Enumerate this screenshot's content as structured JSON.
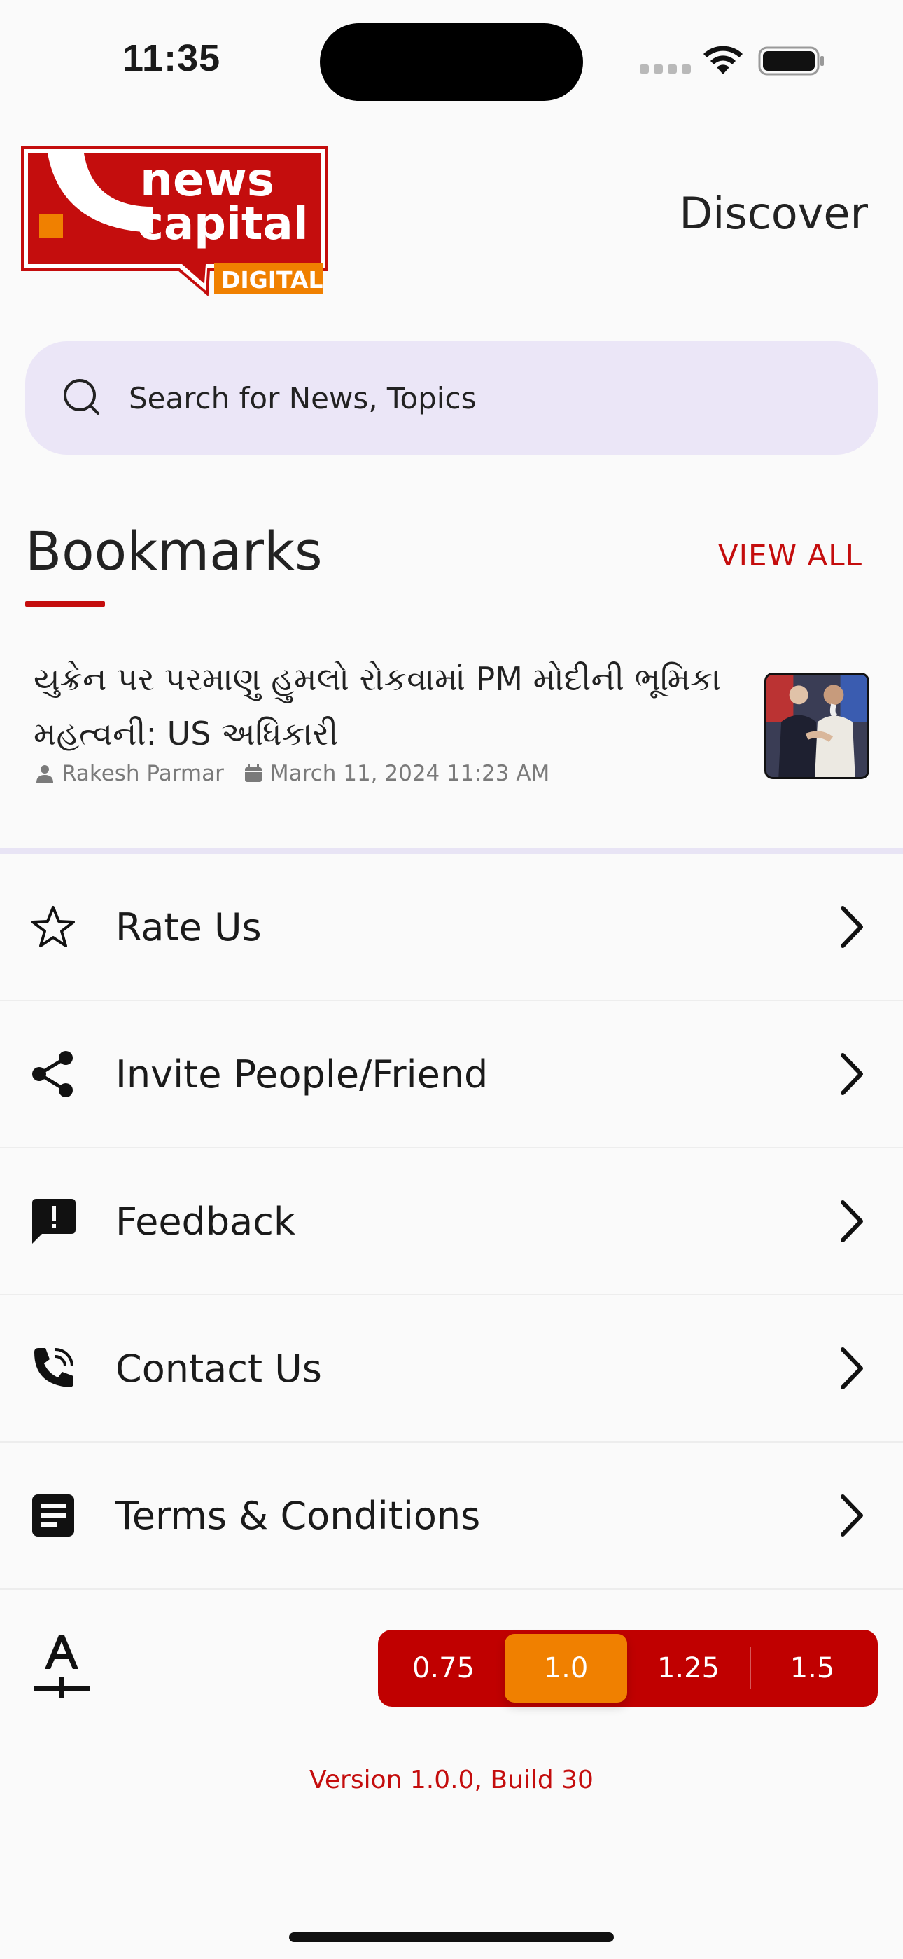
{
  "status_bar": {
    "time": "11:35"
  },
  "header": {
    "logo_alt": "news capital DIGITAL",
    "logo_line1": "news",
    "logo_line2": "capital",
    "logo_line3": "DIGITAL",
    "discover_label": "Discover"
  },
  "search": {
    "placeholder": "Search for News, Topics"
  },
  "bookmarks": {
    "title": "Bookmarks",
    "view_all_label": "VIEW ALL",
    "items": [
      {
        "title": "યુક્રેન પર પરમાણુ હુમલો રોકવામાં PM મોદીની ભૂમિકા મહત્વની: US અધિકારી",
        "author": "Rakesh Parmar",
        "date": "March 11, 2024 11:23 AM"
      }
    ]
  },
  "menu": {
    "items": [
      {
        "label": "Rate Us",
        "icon": "star-outline-icon"
      },
      {
        "label": "Invite People/Friend",
        "icon": "share-icon"
      },
      {
        "label": "Feedback",
        "icon": "feedback-icon"
      },
      {
        "label": "Contact Us",
        "icon": "phone-call-icon"
      },
      {
        "label": "Terms & Conditions",
        "icon": "document-icon"
      }
    ]
  },
  "font_size": {
    "options": [
      "0.75",
      "1.0",
      "1.25",
      "1.5"
    ],
    "selected": "1.0"
  },
  "version_text": "Version 1.0.0, Build 30",
  "colors": {
    "accent": "#c40d0d",
    "segment_bg": "#c00000",
    "segment_active": "#f08000",
    "search_bg": "#ebe6f7"
  }
}
